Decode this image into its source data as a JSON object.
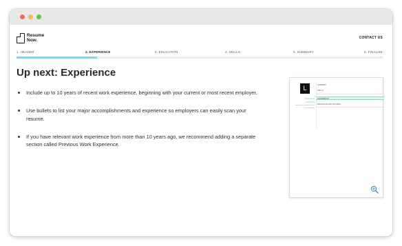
{
  "window": {
    "colors": {
      "red": "#ef6b5e",
      "yellow": "#f4bf4f",
      "green": "#5fc453"
    }
  },
  "header": {
    "logo": {
      "icon": "document-icon",
      "line1": "Resume",
      "line2": "Now."
    },
    "contact_label": "CONTACT US"
  },
  "progress": {
    "steps": [
      {
        "label": "1. HEADER",
        "active": false
      },
      {
        "label": "2. EXPERIENCE",
        "active": true
      },
      {
        "label": "3. EDUCATION",
        "active": false
      },
      {
        "label": "4. SKILLS",
        "active": false
      },
      {
        "label": "5. SUMMARY",
        "active": false
      },
      {
        "label": "6. FINALIZE",
        "active": false
      }
    ],
    "fraction": 0.22,
    "fill_color": "#93d0df"
  },
  "main": {
    "title": "Up next: Experience",
    "bullets": [
      "Include up to 10 years of recent work experience, beginning with your current or most recent employer.",
      "Use bullets to list your major accomplishments and experience so employers can easily scan your resume.",
      "If you have relevant work experience from more than 10 years ago, we recommend adding a separate section called Previous Work Experience."
    ]
  },
  "preview": {
    "monogram": "L",
    "first_name": "First Name",
    "last_name": "Last Name",
    "sections": [
      "SUMMARY",
      "SKILLS",
      "EXPERIENCE",
      "EDUCATION AND TRAINING"
    ],
    "highlighted_section": "EXPERIENCE",
    "accent_color": "#6fb7b0",
    "zoom_icon": "zoom-in-icon"
  }
}
